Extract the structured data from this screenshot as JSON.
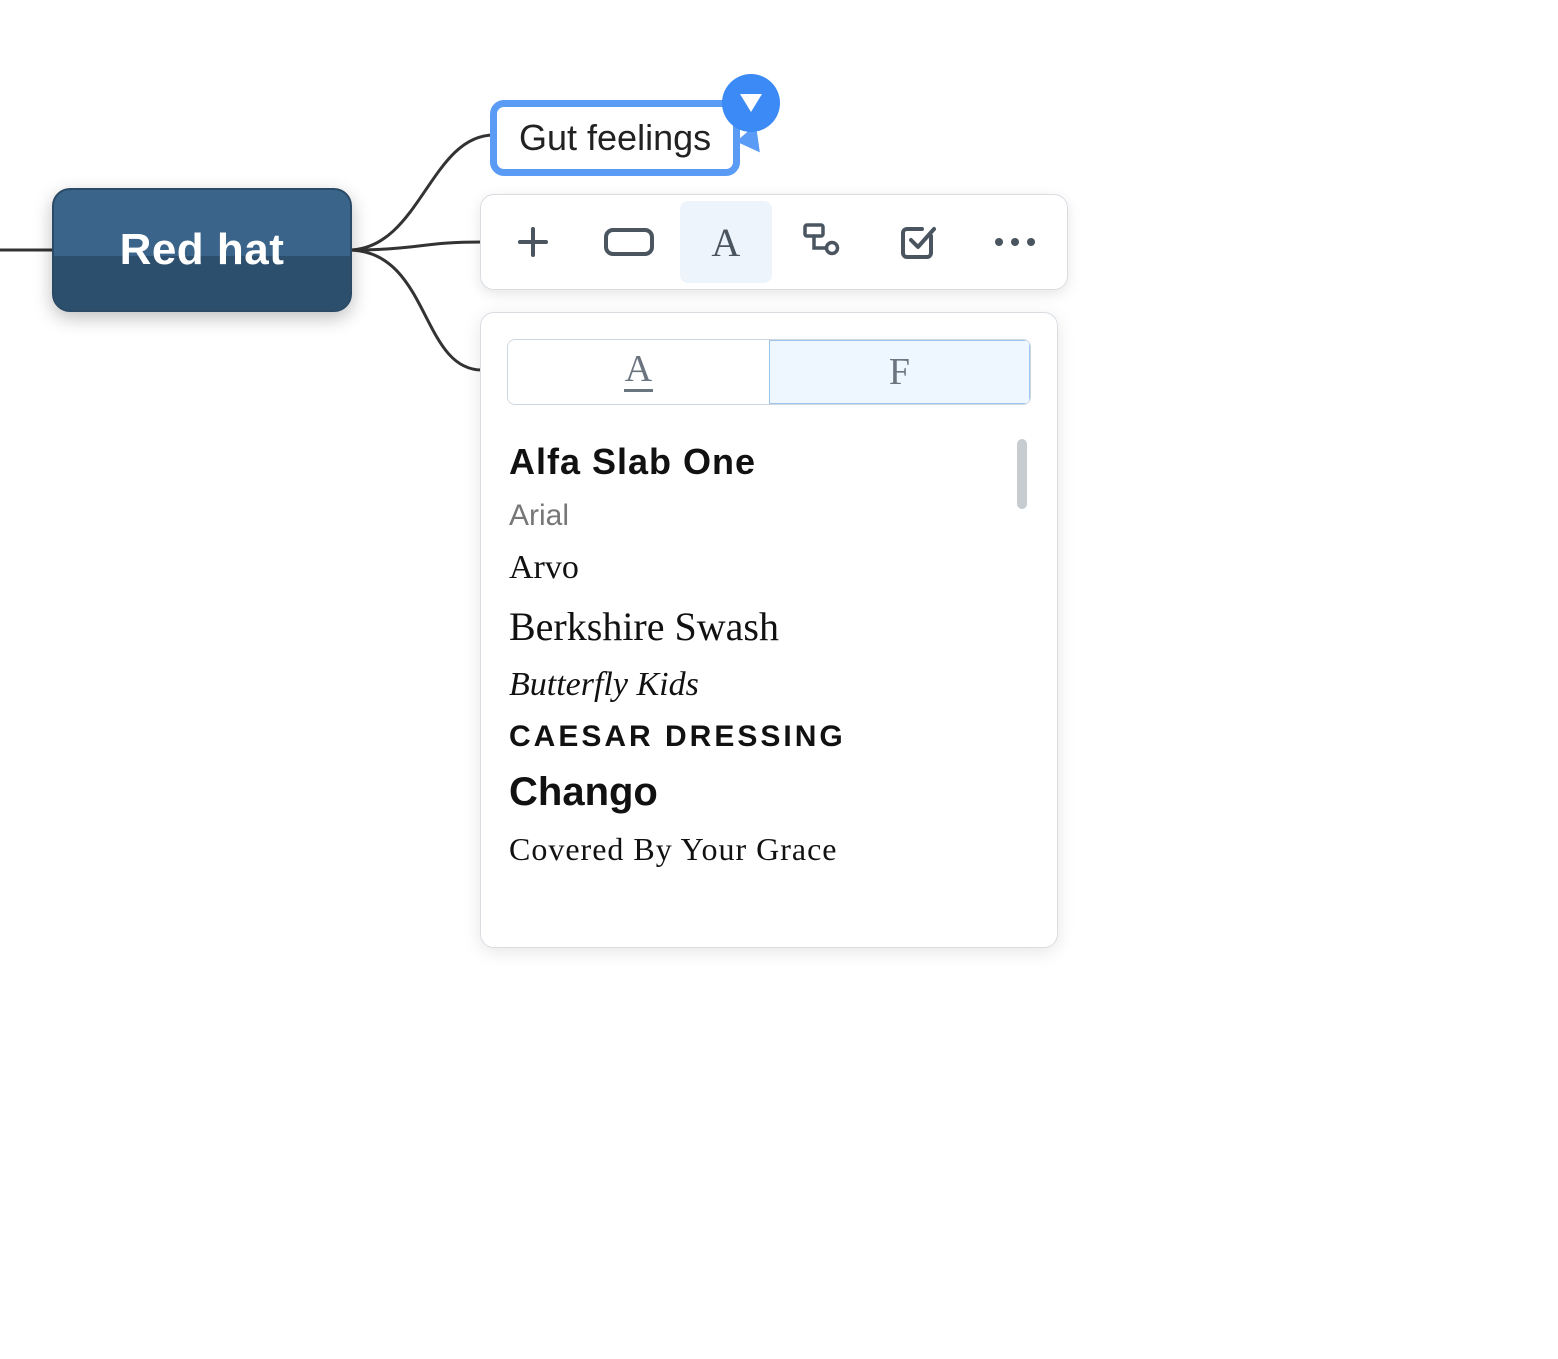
{
  "mindmap": {
    "central_label": "Red hat",
    "child_label": "Gut feelings"
  },
  "toolbar": {
    "add_icon": "plus",
    "shape_icon": "rectangle",
    "text_icon": "A",
    "relation_icon": "outline",
    "task_icon": "check",
    "more_icon": "dots"
  },
  "font_panel": {
    "tab_style_label": "A",
    "tab_font_label": "F",
    "active_tab": "font",
    "fonts": [
      "Alfa Slab One",
      "Arial",
      "Arvo",
      "Berkshire Swash",
      "Butterfly Kids",
      "CAESAR DRESSING",
      "Chango",
      "Covered By Your Grace"
    ]
  }
}
